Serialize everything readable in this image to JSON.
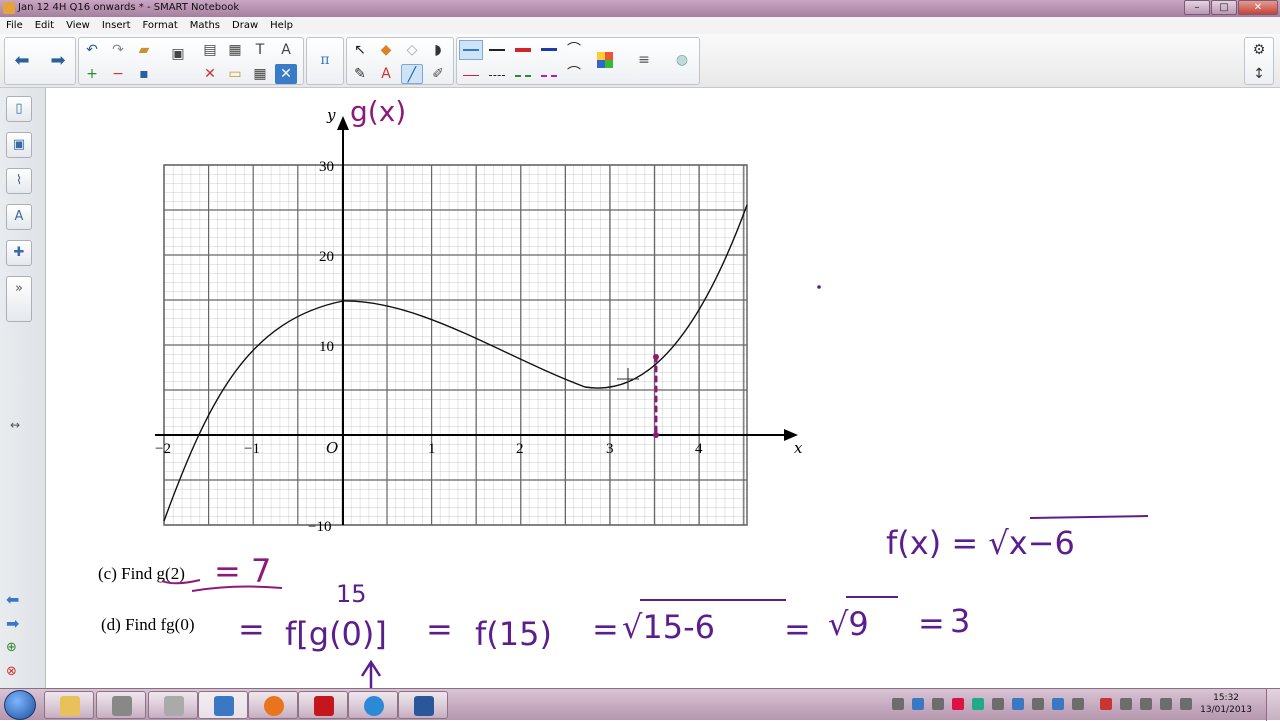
{
  "window": {
    "title": "Jan 12 4H Q16 onwards * - SMART Notebook"
  },
  "menu": [
    "File",
    "Edit",
    "View",
    "Insert",
    "Format",
    "Maths",
    "Draw",
    "Help"
  ],
  "graph": {
    "y_axis_label": "y",
    "x_axis_label": "x",
    "origin_label": "O",
    "x_ticks": [
      "−2",
      "−1",
      "1",
      "2",
      "3",
      "4"
    ],
    "y_ticks": [
      "30",
      "20",
      "10",
      "−10"
    ],
    "handwritten_title": "g(x)"
  },
  "questions": {
    "c_label": "(c)  Find g(2)",
    "c_answer": "= 7",
    "d_label": "(d)  Find fg(0)",
    "d_working": [
      "=",
      "f[g(0)]",
      "=",
      "f(15)",
      "=",
      "√15-6",
      "=",
      "√9",
      "=",
      "3"
    ],
    "d_annotation": "15"
  },
  "side_note": "f(x) = √x−6",
  "taskbar": {
    "time": "15:32",
    "date": "13/01/2013"
  },
  "colors": {
    "ink_magenta": "#8b1a7a",
    "ink_purple": "#5b1e8c",
    "accent": "#3b78c4"
  }
}
